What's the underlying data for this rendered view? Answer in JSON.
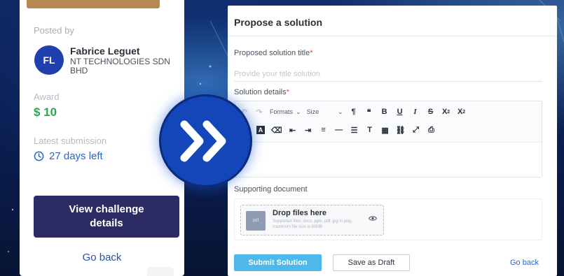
{
  "challenge_card": {
    "posted_by_label": "Posted by",
    "avatar_initials": "FL",
    "poster_name": "Fabrice Leguet",
    "poster_company": "NT TECHNOLOGIES SDN BHD",
    "award_label": "Award",
    "award_value": "$ 10",
    "latest_submission_label": "Latest submission",
    "deadline_text": "27 days left",
    "view_button_label": "View challenge details",
    "go_back_label": "Go back"
  },
  "form": {
    "title": "Propose a solution",
    "solution_title_label": "Proposed solution title",
    "solution_title_placeholder": "Provide your title solution",
    "solution_details_label": "Solution details",
    "required_mark": "*",
    "toolbar": {
      "formats_label": "Formats",
      "size_label": "Size"
    },
    "supporting_document_label": "Supporting document",
    "drop_title": "Drop files here",
    "drop_hint": "Supported files: docx, pptx, pdf, jpg in png, maximum file size is 50MB",
    "doc_thumb_label": "pdf",
    "submit_label": "Submit Solution",
    "draft_label": "Save as Draft",
    "go_back_label": "Go back"
  },
  "colors": {
    "brand_navy": "#2d2b63",
    "award_green": "#2aa655",
    "link_blue": "#2a64c9",
    "submit_blue": "#4fb7ea",
    "arrow_circle": "#1346b8"
  }
}
